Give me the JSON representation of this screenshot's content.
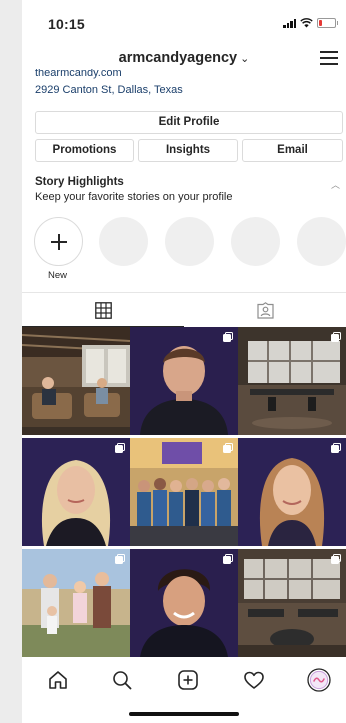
{
  "status_bar": {
    "time": "10:15"
  },
  "header": {
    "username": "armcandyagency",
    "chevron": "⌄"
  },
  "profile": {
    "website": "thearmcandy.com",
    "address": "2929 Canton St, Dallas, Texas"
  },
  "buttons": {
    "edit_profile": "Edit Profile",
    "promotions": "Promotions",
    "insights": "Insights",
    "email": "Email"
  },
  "highlights": {
    "title": "Story Highlights",
    "subtitle": "Keep your favorite stories on your profile",
    "new_label": "New"
  },
  "tabs": [
    {
      "icon": "grid-icon",
      "active": true
    },
    {
      "icon": "tagged-icon",
      "active": false
    }
  ],
  "posts": [
    {
      "subject": "office lounge with people on sofas",
      "multi": false
    },
    {
      "subject": "portrait of man in dark shirt",
      "multi": true
    },
    {
      "subject": "open office workspace",
      "multi": true
    },
    {
      "subject": "portrait of blonde woman",
      "multi": true
    },
    {
      "subject": "team group photo",
      "multi": true
    },
    {
      "subject": "portrait of smiling woman",
      "multi": true
    },
    {
      "subject": "family outdoor photo",
      "multi": true
    },
    {
      "subject": "portrait of young man",
      "multi": true
    },
    {
      "subject": "office interior",
      "multi": true
    }
  ],
  "bottom_nav": [
    "home-icon",
    "search-icon",
    "add-post-icon",
    "heart-icon",
    "profile-avatar"
  ],
  "colors": {
    "link": "#1b3f6b",
    "border": "#dbdbdb",
    "text": "#262626"
  }
}
